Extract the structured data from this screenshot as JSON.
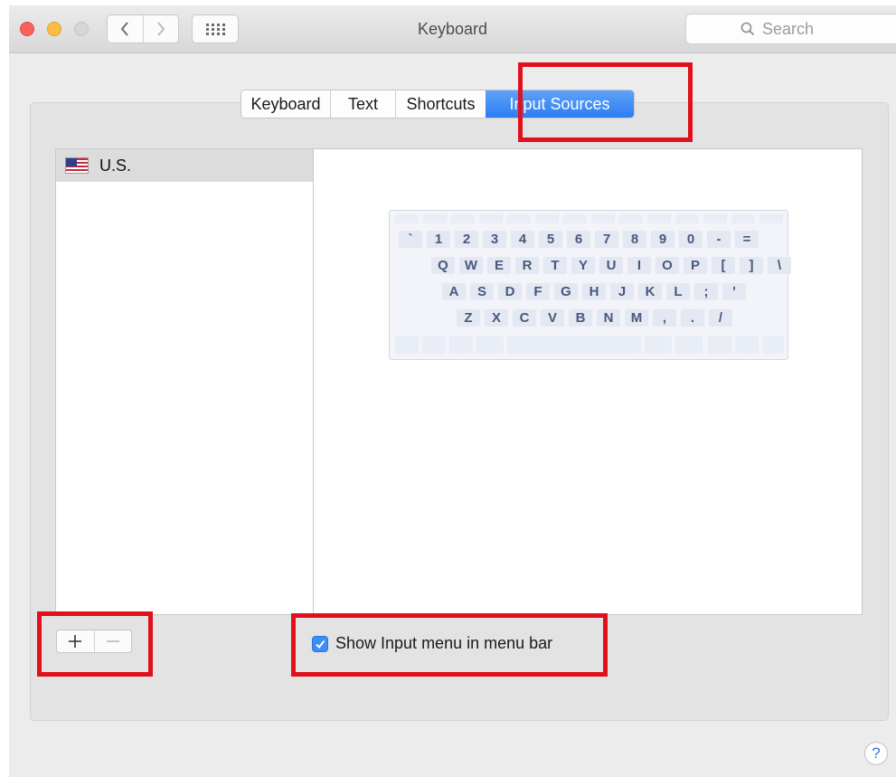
{
  "window": {
    "title": "Keyboard",
    "search_placeholder": "Search"
  },
  "tabs": [
    {
      "label": "Keyboard",
      "active": false
    },
    {
      "label": "Text",
      "active": false
    },
    {
      "label": "Shortcuts",
      "active": false
    },
    {
      "label": "Input Sources",
      "active": true
    }
  ],
  "input_sources": {
    "items": [
      {
        "label": "U.S.",
        "icon": "us-flag-icon",
        "selected": true
      }
    ]
  },
  "keyboard_layout": {
    "rows": [
      [
        "`",
        "1",
        "2",
        "3",
        "4",
        "5",
        "6",
        "7",
        "8",
        "9",
        "0",
        "-",
        "="
      ],
      [
        "Q",
        "W",
        "E",
        "R",
        "T",
        "Y",
        "U",
        "I",
        "O",
        "P",
        "[",
        "]",
        "\\"
      ],
      [
        "A",
        "S",
        "D",
        "F",
        "G",
        "H",
        "J",
        "K",
        "L",
        ";",
        "'"
      ],
      [
        "Z",
        "X",
        "C",
        "V",
        "B",
        "N",
        "M",
        ",",
        ".",
        "/"
      ]
    ]
  },
  "list_controls": {
    "add_icon": "plus-icon",
    "remove_icon": "minus-icon"
  },
  "options": {
    "show_input_menu_label": "Show Input menu in menu bar",
    "show_input_menu_checked": true
  },
  "help": {
    "label": "?"
  },
  "colors": {
    "accent": "#3b8ef3",
    "highlight": "#e0101c"
  }
}
